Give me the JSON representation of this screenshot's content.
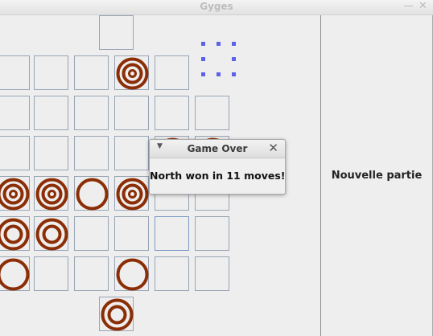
{
  "window": {
    "title": "Gyges",
    "minimize_glyph": "—",
    "close_glyph": "✕"
  },
  "colors": {
    "piece": "#8b2e06",
    "cell_border": "#98a4b4",
    "selection_handle": "#5b63e8"
  },
  "board": {
    "top_goal": {
      "piece": null
    },
    "rows": [
      [
        null,
        null,
        null,
        3,
        null,
        null
      ],
      [
        null,
        null,
        null,
        null,
        null,
        null
      ],
      [
        null,
        null,
        null,
        null,
        2,
        2
      ],
      [
        3,
        3,
        1,
        3,
        null,
        null
      ],
      [
        2,
        2,
        null,
        null,
        null,
        null
      ],
      [
        1,
        null,
        null,
        1,
        null,
        null
      ]
    ],
    "bottom_goal": {
      "piece": 2
    },
    "selected_cell": {
      "row": 4,
      "col": 4
    },
    "dragging_cell": {
      "row": 0,
      "col": 5
    }
  },
  "side_panel": {
    "new_game_label": "Nouvelle partie"
  },
  "dialog": {
    "title": "Game Over",
    "message": "North won in 11 moves!",
    "menu_glyph": "▼",
    "close_glyph": "✕"
  }
}
